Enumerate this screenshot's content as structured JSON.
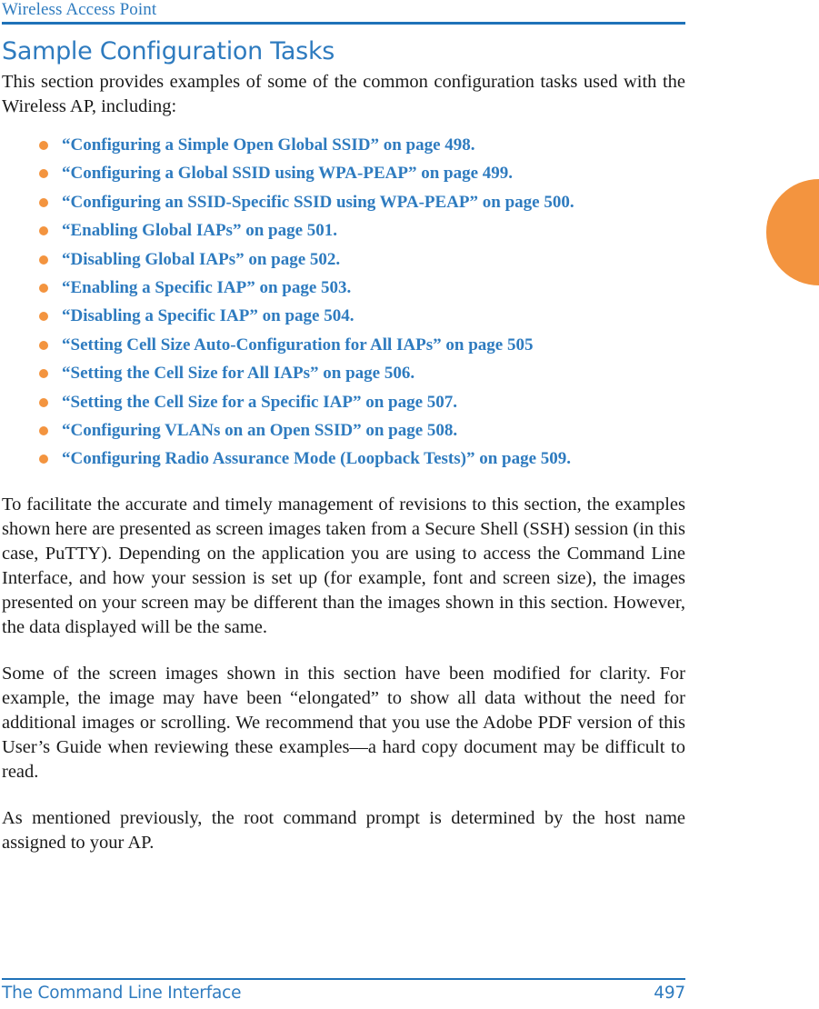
{
  "header": {
    "running_title": "Wireless Access Point"
  },
  "main": {
    "section_title": "Sample Configuration Tasks",
    "lead_paragraph": "This section provides examples of some of the common configuration tasks used with the Wireless AP, including:",
    "cross_references": [
      "“Configuring a Simple Open Global SSID” on page 498.",
      "“Configuring a Global SSID using WPA-PEAP” on page 499.",
      "“Configuring an SSID-Specific SSID using WPA-PEAP” on page 500.",
      "“Enabling Global IAPs” on page 501.",
      "“Disabling Global IAPs” on page 502.",
      "“Enabling a Specific IAP” on page 503.",
      "“Disabling a Specific IAP” on page 504.",
      "“Setting Cell Size Auto-Configuration for All IAPs” on page 505",
      "“Setting the Cell Size for All IAPs” on page 506.",
      "“Setting the Cell Size for a Specific IAP” on page 507.",
      "“Configuring VLANs on an Open SSID” on page 508.",
      "“Configuring Radio Assurance Mode (Loopback Tests)” on page 509."
    ],
    "paragraph_1": "To facilitate the accurate and timely management of revisions to this section, the examples shown here are presented as screen images taken from a Secure Shell (SSH) session (in this case, PuTTY). Depending on the application you are using to access the Command Line Interface, and how your session is set up (for example, font and screen size), the images presented on your screen may be different than the images shown in this section. However, the data displayed will be the same.",
    "paragraph_2": "Some of the screen images shown in this section have been modified for clarity. For example, the image may have been “elongated” to show all data without the need for additional images or scrolling. We recommend that you use the Adobe PDF version of this User’s Guide when reviewing these examples—a hard copy document may be difficult to read.",
    "paragraph_3": "As mentioned previously, the root command prompt is determined by the host name assigned to your AP."
  },
  "footer": {
    "chapter_title": "The Command Line Interface",
    "page_number": "497"
  },
  "colors": {
    "heading_blue": "#2E7BBF",
    "rule_blue": "#1F72B8",
    "bullet_orange": "#F3943F",
    "body_text": "#1a1a1a"
  }
}
